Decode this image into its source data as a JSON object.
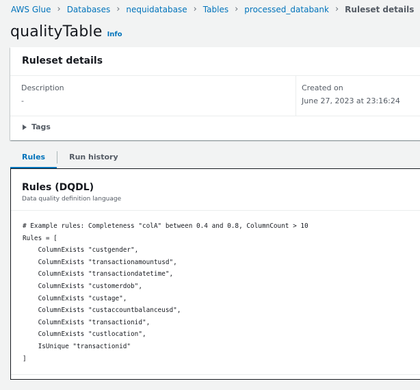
{
  "breadcrumb": {
    "items": [
      "AWS Glue",
      "Databases",
      "nequidatabase",
      "Tables",
      "processed_databank"
    ],
    "current": "Ruleset details"
  },
  "page": {
    "title": "qualityTable",
    "info": "Info"
  },
  "details": {
    "title": "Ruleset details",
    "description_label": "Description",
    "description_value": "-",
    "created_label": "Created on",
    "created_value": "June 27, 2023 at 23:16:24",
    "tags_label": "Tags"
  },
  "tabs": [
    "Rules",
    "Run history"
  ],
  "rules": {
    "title": "Rules (DQDL)",
    "subtitle": "Data quality definition language",
    "code": "# Example rules: Completeness \"colA\" between 0.4 and 0.8, ColumnCount > 10\nRules = [\n    ColumnExists \"custgender\",\n    ColumnExists \"transactionamountusd\",\n    ColumnExists \"transactiondatetime\",\n    ColumnExists \"customerdob\",\n    ColumnExists \"custage\",\n    ColumnExists \"custaccountbalanceusd\",\n    ColumnExists \"transactionid\",\n    ColumnExists \"custlocation\",\n    IsUnique \"transactionid\"\n]"
  },
  "colors": {
    "link": "#0073bb",
    "text": "#16191f",
    "muted": "#545b64",
    "background": "#f2f3f3"
  }
}
